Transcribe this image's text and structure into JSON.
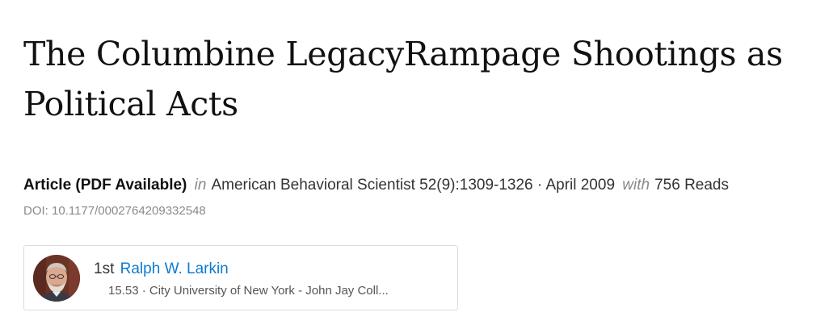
{
  "article": {
    "title": "The Columbine LegacyRampage Shootings as Political Acts",
    "type": "Article (PDF Available)",
    "in_label": "in",
    "journal": "American Behavioral Scientist 52(9):1309-1326 · April 2009",
    "with_label": "with",
    "reads": "756 Reads",
    "doi": "DOI: 10.1177/0002764209332548"
  },
  "author": {
    "rank": "1st",
    "name": "Ralph W. Larkin",
    "score_affiliation": "15.53 · City University of New York - John Jay Coll..."
  },
  "colors": {
    "link": "#0b7bd3",
    "muted": "#8a8a8a",
    "border": "#dcdcdc"
  }
}
